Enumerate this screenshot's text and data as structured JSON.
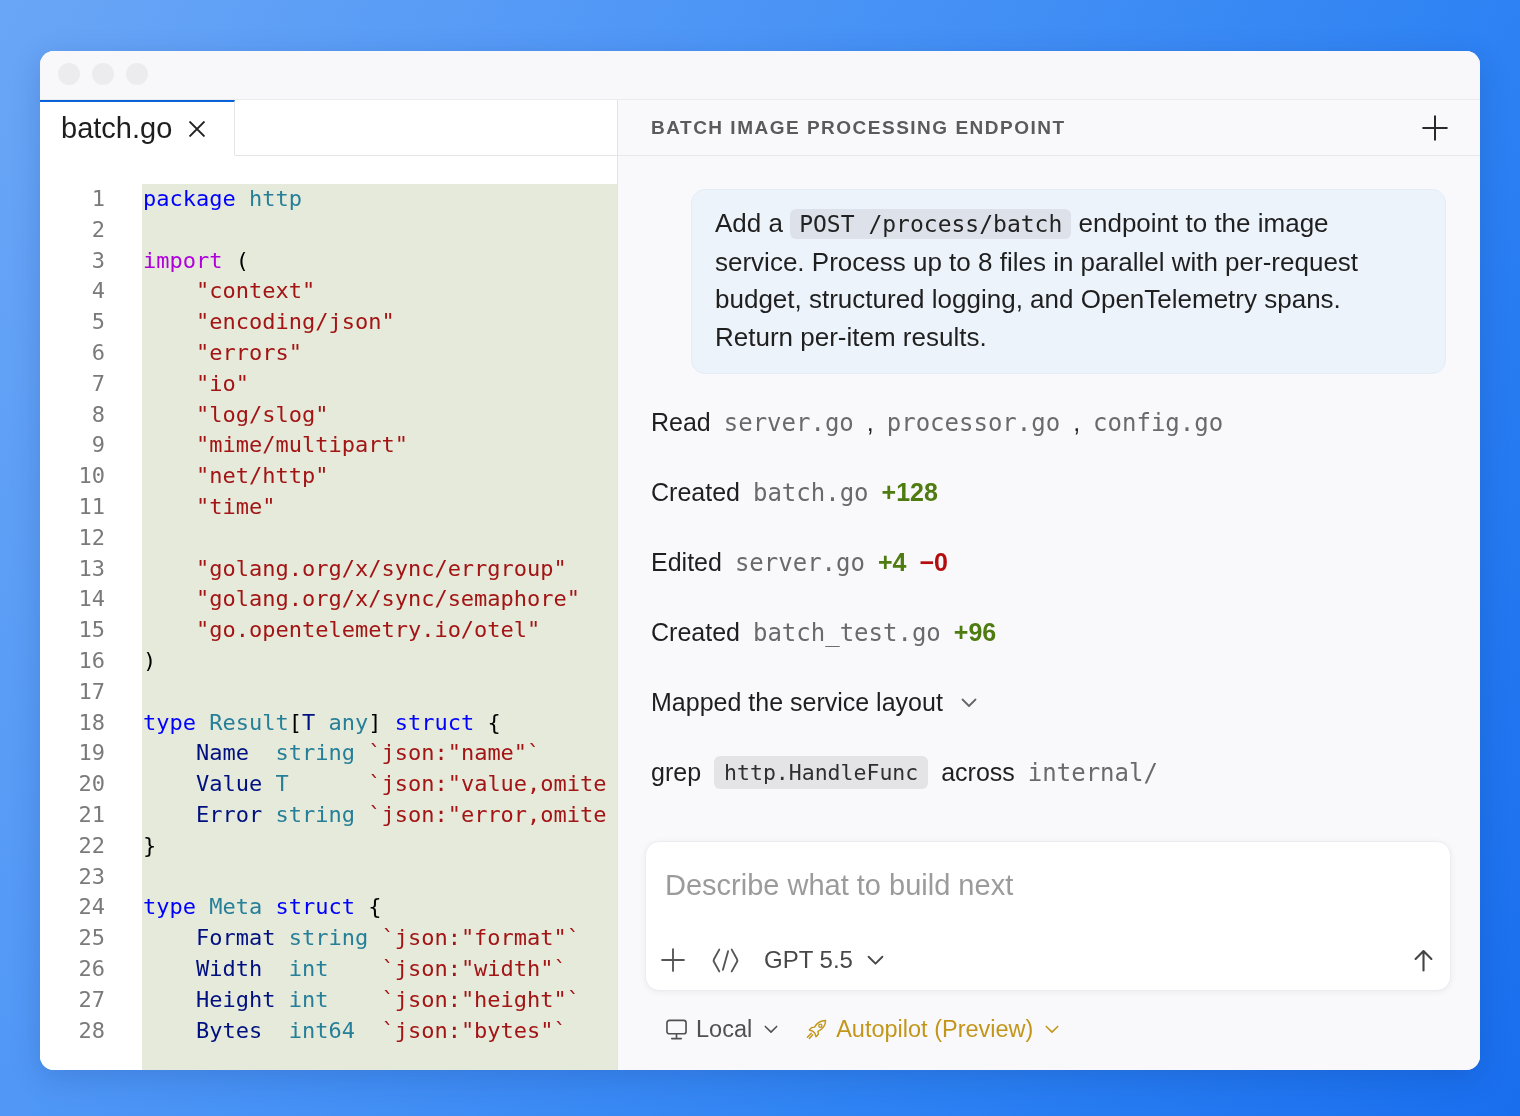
{
  "editor": {
    "tabs": [
      {
        "label": "batch.go",
        "selected": true
      }
    ],
    "lines": [
      {
        "number": "1",
        "tokens": [
          {
            "kind": "keyword",
            "text": "package "
          },
          {
            "kind": "type",
            "text": "http"
          }
        ]
      },
      {
        "number": "2"
      },
      {
        "number": "3",
        "tokens": [
          {
            "kind": "control",
            "text": "import "
          },
          {
            "kind": "plain",
            "text": "("
          }
        ],
        "children": [
          {
            "number": "4",
            "tokens": [
              {
                "kind": "string",
                "text": "\"context\""
              }
            ]
          },
          {
            "number": "5",
            "tokens": [
              {
                "kind": "string",
                "text": "\"encoding/json\""
              }
            ]
          },
          {
            "number": "6",
            "tokens": [
              {
                "kind": "string",
                "text": "\"errors\""
              }
            ]
          },
          {
            "number": "7",
            "tokens": [
              {
                "kind": "string",
                "text": "\"io\""
              }
            ]
          },
          {
            "number": "8",
            "tokens": [
              {
                "kind": "string",
                "text": "\"log/slog\""
              }
            ]
          },
          {
            "number": "9",
            "tokens": [
              {
                "kind": "string",
                "text": "\"mime/multipart\""
              }
            ]
          },
          {
            "number": "10",
            "tokens": [
              {
                "kind": "string",
                "text": "\"net/http\""
              }
            ]
          },
          {
            "number": "11",
            "tokens": [
              {
                "kind": "string",
                "text": "\"time\""
              }
            ]
          },
          {
            "number": "12"
          },
          {
            "number": "13",
            "tokens": [
              {
                "kind": "string",
                "text": "\"golang.org/x/sync/errgroup\""
              }
            ]
          },
          {
            "number": "14",
            "tokens": [
              {
                "kind": "string",
                "text": "\"golang.org/x/sync/semaphore\""
              }
            ]
          },
          {
            "number": "15",
            "tokens": [
              {
                "kind": "string",
                "text": "\"go.opentelemetry.io/otel\""
              }
            ]
          }
        ]
      },
      {
        "number": "16",
        "tokens": [
          {
            "kind": "plain",
            "text": ")"
          }
        ]
      },
      {
        "number": "17"
      },
      {
        "number": "18",
        "tokens": [
          {
            "kind": "keyword",
            "text": "type "
          },
          {
            "kind": "type",
            "text": "Result"
          },
          {
            "kind": "plain",
            "text": "["
          },
          {
            "kind": "field",
            "text": "T "
          },
          {
            "kind": "type",
            "text": "any"
          },
          {
            "kind": "plain",
            "text": "] "
          },
          {
            "kind": "keyword",
            "text": "struct "
          },
          {
            "kind": "plain",
            "text": "{"
          }
        ],
        "children": [
          {
            "number": "19",
            "tokens": [
              {
                "kind": "field",
                "text": "Name  "
              },
              {
                "kind": "type",
                "text": "string "
              },
              {
                "kind": "string",
                "text": "`json:\"name\"`"
              }
            ]
          },
          {
            "number": "20",
            "tokens": [
              {
                "kind": "field",
                "text": "Value "
              },
              {
                "kind": "type",
                "text": "T      "
              },
              {
                "kind": "string",
                "text": "`json:\"value,omite"
              }
            ]
          },
          {
            "number": "21",
            "tokens": [
              {
                "kind": "field",
                "text": "Error "
              },
              {
                "kind": "type",
                "text": "string "
              },
              {
                "kind": "string",
                "text": "`json:\"error,omite"
              }
            ]
          }
        ]
      },
      {
        "number": "22",
        "tokens": [
          {
            "kind": "plain",
            "text": "}"
          }
        ]
      },
      {
        "number": "23"
      },
      {
        "number": "24",
        "tokens": [
          {
            "kind": "keyword",
            "text": "type "
          },
          {
            "kind": "type",
            "text": "Meta "
          },
          {
            "kind": "keyword",
            "text": "struct "
          },
          {
            "kind": "plain",
            "text": "{"
          }
        ],
        "children": [
          {
            "number": "25",
            "tokens": [
              {
                "kind": "field",
                "text": "Format "
              },
              {
                "kind": "type",
                "text": "string "
              },
              {
                "kind": "string",
                "text": "`json:\"format\"`"
              }
            ]
          },
          {
            "number": "26",
            "tokens": [
              {
                "kind": "field",
                "text": "Width  "
              },
              {
                "kind": "type",
                "text": "int    "
              },
              {
                "kind": "string",
                "text": "`json:\"width\"`"
              }
            ]
          },
          {
            "number": "27",
            "tokens": [
              {
                "kind": "field",
                "text": "Height "
              },
              {
                "kind": "type",
                "text": "int    "
              },
              {
                "kind": "string",
                "text": "`json:\"height\"`"
              }
            ]
          },
          {
            "number": "28",
            "tokens": [
              {
                "kind": "field",
                "text": "Bytes  "
              },
              {
                "kind": "type",
                "text": "int64  "
              },
              {
                "kind": "string",
                "text": "`json:\"bytes\"`"
              }
            ]
          }
        ]
      }
    ]
  },
  "chat": {
    "title": "BATCH IMAGE PROCESSING ENDPOINT",
    "message": {
      "segments": [
        {
          "kind": "text",
          "text": "Add a "
        },
        {
          "kind": "code",
          "text": "POST /process/batch"
        },
        {
          "kind": "text",
          "text": " endpoint to the image service. Process up to 8 files in parallel with per-request budget, structured logging, and OpenTelemetry spans. Return per-item results."
        }
      ]
    },
    "activity": [
      {
        "kind": "step",
        "parts": [
          {
            "kind": "text",
            "text": "Read"
          },
          {
            "kind": "file",
            "text": "server.go"
          },
          {
            "kind": "punct",
            "text": ","
          },
          {
            "kind": "file",
            "text": "processor.go"
          },
          {
            "kind": "punct",
            "text": ","
          },
          {
            "kind": "file",
            "text": "config.go"
          }
        ]
      },
      {
        "kind": "step",
        "parts": [
          {
            "kind": "text",
            "text": "Created"
          },
          {
            "kind": "file",
            "text": "batch.go"
          },
          {
            "kind": "added",
            "text": "+128"
          }
        ]
      },
      {
        "kind": "step",
        "parts": [
          {
            "kind": "text",
            "text": "Edited"
          },
          {
            "kind": "file",
            "text": "server.go"
          },
          {
            "kind": "added",
            "text": "+4"
          },
          {
            "kind": "removed",
            "text": "−0"
          }
        ]
      },
      {
        "kind": "step",
        "parts": [
          {
            "kind": "text",
            "text": "Created"
          },
          {
            "kind": "file",
            "text": "batch_test.go"
          },
          {
            "kind": "added",
            "text": "+96"
          }
        ]
      },
      {
        "kind": "group",
        "label": "Mapped the service layout",
        "expanded": false
      },
      {
        "kind": "step",
        "parts": [
          {
            "kind": "text",
            "text": "grep"
          },
          {
            "kind": "pattern",
            "text": "http.HandleFunc"
          },
          {
            "kind": "text",
            "text": "across"
          },
          {
            "kind": "file",
            "text": "internal/"
          }
        ]
      }
    ],
    "composer": {
      "placeholder": "Describe what to build next",
      "model": "GPT 5.5"
    },
    "footer": [
      {
        "kind": "environment",
        "label": "Local"
      },
      {
        "kind": "mode",
        "label": "Autopilot (Preview)"
      }
    ]
  }
}
